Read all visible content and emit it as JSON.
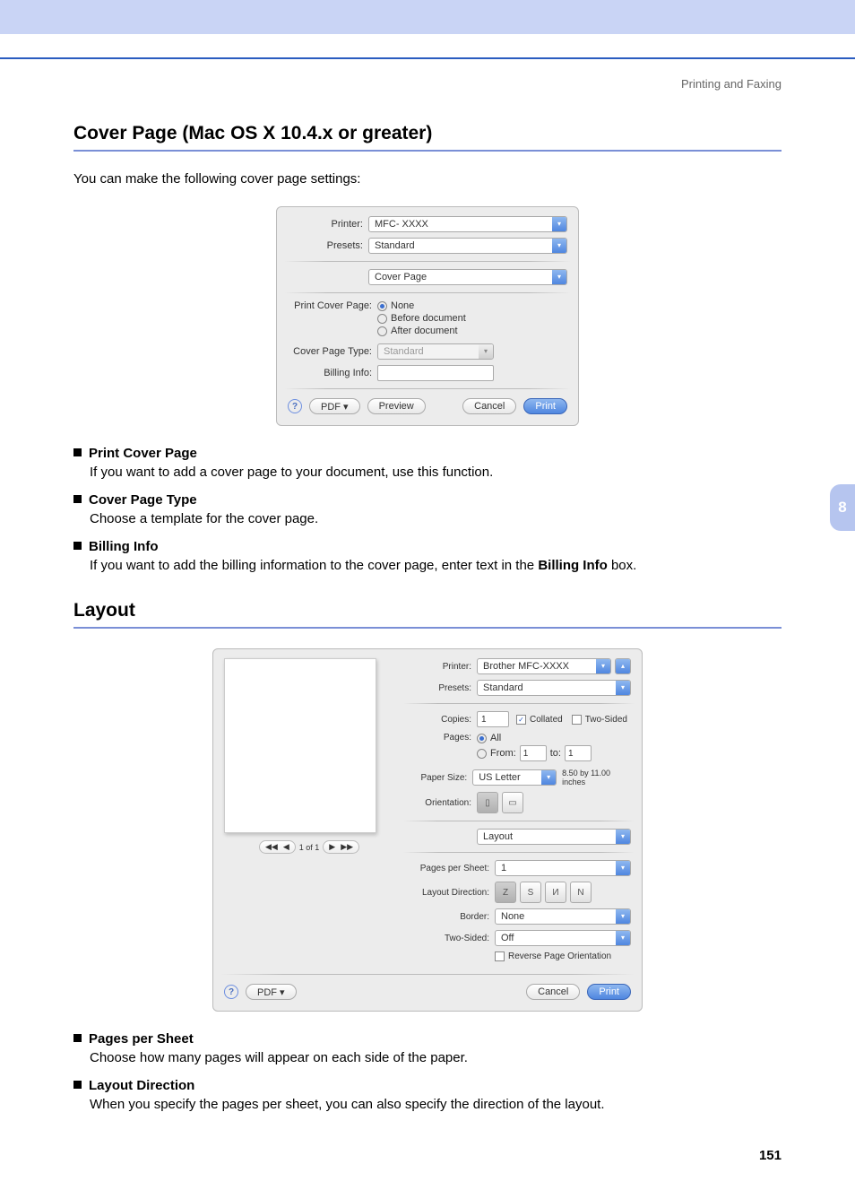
{
  "breadcrumb": "Printing and Faxing",
  "side_tab": "8",
  "page_number": "151",
  "section1": {
    "title": "Cover Page (Mac OS X 10.4.x or greater)",
    "intro": "You can make the following cover page settings:"
  },
  "dialog1": {
    "printer_label": "Printer:",
    "printer_value": "MFC- XXXX",
    "presets_label": "Presets:",
    "presets_value": "Standard",
    "pane_value": "Cover Page",
    "pcp_label": "Print Cover Page:",
    "opt_none": "None",
    "opt_before": "Before document",
    "opt_after": "After document",
    "cpt_label": "Cover Page Type:",
    "cpt_value": "Standard",
    "billing_label": "Billing Info:",
    "help": "?",
    "pdf": "PDF ▾",
    "preview": "Preview",
    "cancel": "Cancel",
    "print": "Print"
  },
  "bullets1": [
    {
      "title": "Print Cover Page",
      "desc": "If you want to add a cover page to your document, use this function."
    },
    {
      "title": "Cover Page Type",
      "desc": "Choose a template for the cover page."
    },
    {
      "title": "Billing Info",
      "desc_pre": "If you want to add the billing information to the cover page, enter text in the ",
      "desc_bold": "Billing Info",
      "desc_post": " box."
    }
  ],
  "section2": {
    "title": "Layout"
  },
  "dialog2": {
    "printer_label": "Printer:",
    "printer_value": "Brother MFC-XXXX",
    "presets_label": "Presets:",
    "presets_value": "Standard",
    "copies_label": "Copies:",
    "copies_value": "1",
    "collated": "Collated",
    "twosided_chk": "Two-Sided",
    "pages_label": "Pages:",
    "pages_all": "All",
    "pages_from_lbl": "From:",
    "pages_from": "1",
    "pages_to_lbl": "to:",
    "pages_to": "1",
    "papersize_label": "Paper Size:",
    "papersize_value": "US Letter",
    "papersize_dims": "8.50 by 11.00 inches",
    "orientation_label": "Orientation:",
    "pane_value": "Layout",
    "pps_label": "Pages per Sheet:",
    "pps_value": "1",
    "layoutdir_label": "Layout Direction:",
    "border_label": "Border:",
    "border_value": "None",
    "twosided_label": "Two-Sided:",
    "twosided_value": "Off",
    "reverse": "Reverse Page Orientation",
    "pager_text": "1 of 1",
    "help": "?",
    "pdf": "PDF ▾",
    "cancel": "Cancel",
    "print": "Print"
  },
  "bullets2": [
    {
      "title": "Pages per Sheet",
      "desc": "Choose how many pages will appear on each side of the paper."
    },
    {
      "title": "Layout Direction",
      "desc": "When you specify the pages per sheet, you can also specify the direction of the layout."
    }
  ]
}
